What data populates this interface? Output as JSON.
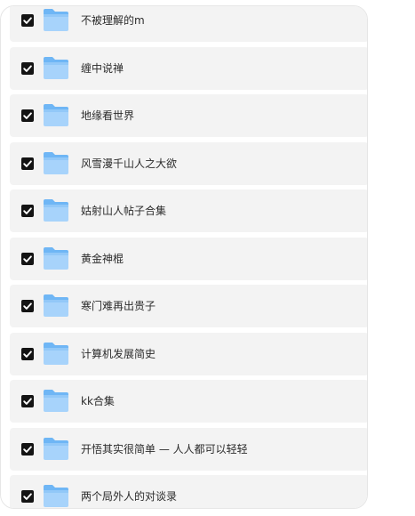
{
  "icons": {
    "checkbox": "checked-checkbox-icon",
    "folder": "folder-icon"
  },
  "colors": {
    "row_background": "#f3f3f3",
    "checkbox": "#141414",
    "folder_light": "#a7d3fb",
    "folder_dark": "#5aaaf2"
  },
  "folders": {
    "items": [
      {
        "name": "不被理解的m",
        "checked": true
      },
      {
        "name": "缠中说禅",
        "checked": true
      },
      {
        "name": "地缘看世界",
        "checked": true
      },
      {
        "name": "风雪漫千山人之大欲",
        "checked": true
      },
      {
        "name": "姑射山人帖子合集",
        "checked": true
      },
      {
        "name": "黄金神棍",
        "checked": true
      },
      {
        "name": "寒门难再出贵子",
        "checked": true
      },
      {
        "name": "计算机发展简史",
        "checked": true
      },
      {
        "name": "kk合集",
        "checked": true
      },
      {
        "name": "开悟其实很简单 — 人人都可以轻轻",
        "checked": true
      },
      {
        "name": "两个局外人的对谈录",
        "checked": true
      }
    ]
  }
}
